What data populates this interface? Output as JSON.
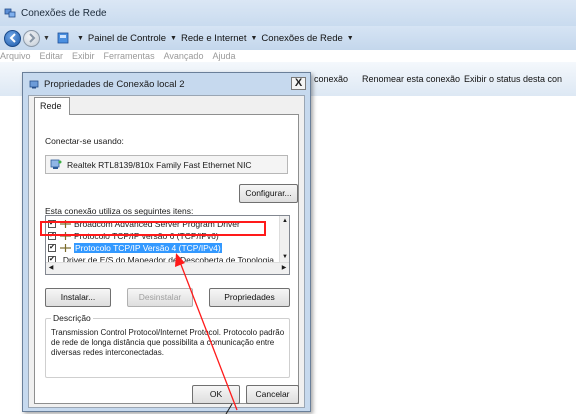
{
  "window": {
    "title": "Conexões de Rede"
  },
  "address": {
    "breadcrumbs": [
      "Painel de Controle",
      "Rede e Internet",
      "Conexões de Rede"
    ]
  },
  "menu": {
    "items": [
      "Arquivo",
      "Editar",
      "Exibir",
      "Ferramentas",
      "Avançado",
      "Ajuda"
    ]
  },
  "commands": {
    "items": [
      "conexão",
      "Renomear esta conexão",
      "Exibir o status desta con"
    ]
  },
  "dialog": {
    "title": "Propriedades de Conexão local 2",
    "close_label": "X",
    "tab": "Rede",
    "connect_using_label": "Conectar-se usando:",
    "adapter": "Realtek RTL8139/810x Family Fast Ethernet NIC",
    "configure_button": "Configurar...",
    "items_label": "Esta conexão utiliza os seguintes itens:",
    "items": [
      {
        "label": "Broadcom Advanced Server Program Driver",
        "checked": true,
        "selected": false
      },
      {
        "label": "Protocolo TCP/IP versão 6 (TCP/IPv6)",
        "checked": true,
        "selected": false
      },
      {
        "label": "Protocolo TCP/IP Versão 4 (TCP/IPv4)",
        "checked": true,
        "selected": true
      },
      {
        "label": "Driver de E/S do Mapeador de Descoberta de Topologia",
        "checked": true,
        "selected": false
      }
    ],
    "check_mark": "✔",
    "install_button": "Instalar...",
    "uninstall_button": "Desinstalar",
    "properties_button": "Propriedades",
    "description_legend": "Descrição",
    "description_text": "Transmission Control Protocol/Internet Protocol. Protocolo padrão de rede de longa distância que possibilita a comunicação entre diversas redes interconectadas.",
    "ok_button": "OK",
    "cancel_button": "Cancelar"
  },
  "colors": {
    "highlight": "#ff1a1a",
    "selection": "#3399ff"
  }
}
